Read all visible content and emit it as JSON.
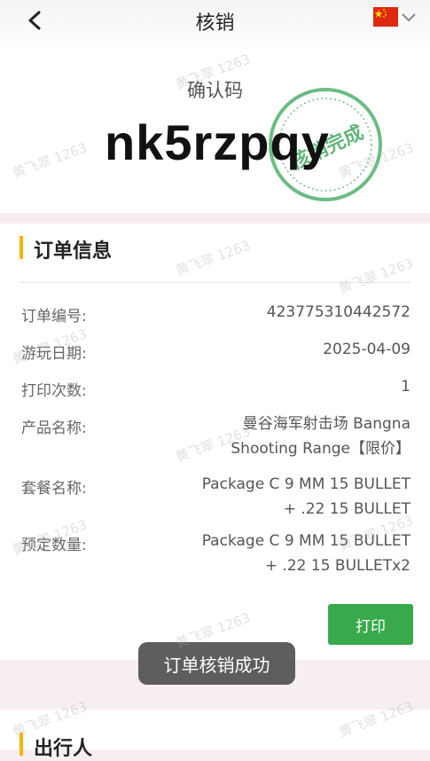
{
  "header": {
    "title": "核销",
    "language_icon": "china-flag-icon"
  },
  "code": {
    "label": "确认码",
    "value": "nk5rzpqy",
    "stamp_text": "核销完成"
  },
  "order": {
    "section_title": "订单信息",
    "rows": [
      {
        "label": "订单编号:",
        "value": "423775310442572"
      },
      {
        "label": "游玩日期:",
        "value": "2025-04-09"
      },
      {
        "label": "打印次数:",
        "value": "1"
      },
      {
        "label": "产品名称:",
        "value": "曼谷海军射击场 Bangna Shooting Range【限价】"
      },
      {
        "label": "套餐名称:",
        "value": "Package C 9 MM 15 BULLET + .22 15 BULLET"
      },
      {
        "label": "预定数量:",
        "value": "Package C 9 MM 15 BULLET + .22 15 BULLETx2"
      }
    ],
    "print_label": "打印"
  },
  "toast": {
    "text": "订单核销成功"
  },
  "travelers": {
    "section_title": "出行人"
  },
  "watermark": {
    "text": "黄飞翠 1263"
  },
  "colors": {
    "accent": "#f2b600",
    "print_button": "#39a94d",
    "stamp": "#3aa55a"
  }
}
